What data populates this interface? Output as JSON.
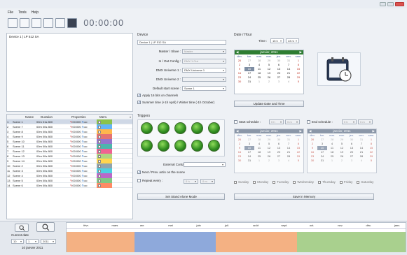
{
  "menu": {
    "file": "File",
    "tools": "Tools",
    "help": "Help"
  },
  "toolbar": {
    "timer": "00:00:00"
  },
  "left": {
    "device_label": "Device 1 | LP 512 SA"
  },
  "device": {
    "section": "Device",
    "name": "Device 1 | LP 512 SA",
    "master_slave_label": "Master / Slave :",
    "master_slave_value": "Master",
    "in_out_label": "In / Out Config :",
    "in_out_value": "DMX 1 Out",
    "dmx1_label": "DMX Universe 1 :",
    "dmx1_value": "DMX Universe 1",
    "dmx2_label": "DMX Universe 2 :",
    "dmx2_value": "",
    "start_scene_label": "Default start scene :",
    "start_scene_value": "Scene 1",
    "apply16_label": "Apply 16 bits on channels",
    "summer_label": "Summer time (+1h April) / Winter time (-1h October)"
  },
  "datehour": {
    "section": "Date / Hour",
    "time_label": "Time :",
    "hour": "15 h",
    "minute": "43 m",
    "update_button": "Update Date and Time"
  },
  "main_calendar": {
    "title": "janvier, 2011",
    "weekdays": [
      "dim.",
      "lun.",
      "mar.",
      "mer.",
      "jeu.",
      "ven.",
      "sam."
    ],
    "days": [
      "26",
      "27",
      "28",
      "29",
      "30",
      "31",
      "1",
      "2",
      "3",
      "4",
      "5",
      "6",
      "7",
      "8",
      "9",
      "10",
      "11",
      "12",
      "13",
      "14",
      "15",
      "16",
      "17",
      "18",
      "19",
      "20",
      "21",
      "22",
      "23",
      "24",
      "25",
      "26",
      "27",
      "28",
      "29",
      "30",
      "31",
      "1",
      "2",
      "3",
      "4",
      "5"
    ]
  },
  "scenes": {
    "headers": {
      "name": "Name",
      "duration": "Duration",
      "properties": "Properties",
      "mem": "Mem."
    },
    "rows": [
      {
        "num": "1",
        "name": "Scene 1",
        "dur": "00m 01s 800",
        "prop": "00:000",
        "loop": "oo"
      },
      {
        "num": "2",
        "name": "Scene 7",
        "dur": "00m 00s 800",
        "prop": "00:000",
        "loop": "oo"
      },
      {
        "num": "3",
        "name": "Scene 8",
        "dur": "00m 00s 800",
        "prop": "00:000",
        "loop": "oo"
      },
      {
        "num": "4",
        "name": "Scene 9",
        "dur": "00m 00s 800",
        "prop": "00:000",
        "loop": "oo"
      },
      {
        "num": "5",
        "name": "Scene 10",
        "dur": "00m 00s 800",
        "prop": "00:000",
        "loop": "oo"
      },
      {
        "num": "6",
        "name": "Scene 11",
        "dur": "00m 00s 800",
        "prop": "00:000",
        "loop": "oo"
      },
      {
        "num": "7",
        "name": "Scene 12",
        "dur": "00m 00s 800",
        "prop": "00:000",
        "loop": "oo"
      },
      {
        "num": "8",
        "name": "Scene 13",
        "dur": "00m 00s 800",
        "prop": "00:000",
        "loop": "oo"
      },
      {
        "num": "9",
        "name": "Scene 14",
        "dur": "00m 00s 800",
        "prop": "00:000",
        "loop": "oo"
      },
      {
        "num": "10",
        "name": "Scene 2",
        "dur": "00m 00s 800",
        "prop": "00:000",
        "loop": "oo"
      },
      {
        "num": "11",
        "name": "Scene 3",
        "dur": "00m 00s 800",
        "prop": "00:000",
        "loop": "oo"
      },
      {
        "num": "12",
        "name": "Scene 4",
        "dur": "00m 00s 800",
        "prop": "00:000",
        "loop": "oo"
      },
      {
        "num": "13",
        "name": "Scene 5",
        "dur": "00m 00s 800",
        "prop": "00:000",
        "loop": "oo"
      },
      {
        "num": "14",
        "name": "Scene 6",
        "dur": "00m 00s 800",
        "prop": "00:000",
        "loop": "oo"
      }
    ],
    "mem_colors": [
      "#8bc34a",
      "#64b5f6",
      "#ffb74d",
      "#e57373",
      "#9575cd",
      "#4db6ac",
      "#f06292",
      "#aed581",
      "#ffd54f",
      "#90a4ae",
      "#4dd0e1",
      "#ba68c8",
      "#81c784",
      "#ff8a65"
    ]
  },
  "triggers": {
    "section": "Triggers",
    "external_label": "External Contacts :",
    "next_prev_label": "Next / Prev. actin on the scene",
    "repeat_label": "Repeat every :",
    "repeat_h": "0 h",
    "repeat_m": "0 m",
    "standalone_button": "Set Stand Alone Mode"
  },
  "schedule": {
    "start_label": "Start schedule :",
    "end_label": "End schedule :",
    "start_h": "0 h",
    "start_m": "0 m",
    "end_h": "0 h",
    "end_m": "0 m",
    "cal_title": "janvier, 2011",
    "weekdays_labels": [
      "Sunday",
      "Monday",
      "Tuesday",
      "Wednesday",
      "Thursday",
      "Friday",
      "Saturday"
    ],
    "save_button": "Save in Memory"
  },
  "bottom": {
    "current_date_label": "Current date",
    "day": "10",
    "month": "1",
    "year": "2011",
    "date_text": "10 janvier 2011",
    "months": [
      "févr.",
      "mars",
      "avr.",
      "mai",
      "juin",
      "juil.",
      "août",
      "sept.",
      "oct.",
      "nov.",
      "déc.",
      "janv."
    ],
    "timeline_colors": [
      "#f4b183",
      "#8ea9db",
      "#f4b183",
      "#a9d08e"
    ]
  }
}
